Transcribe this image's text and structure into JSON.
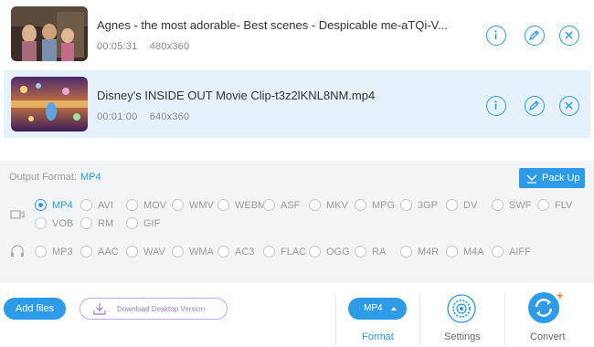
{
  "files": [
    {
      "title": "Agnes - the most adorable- Best scenes - Despicable me-aTQi-V...",
      "duration": "00:05:31",
      "resolution": "480x360",
      "selected": false,
      "thumbnail_icon": "video-thumbnail"
    },
    {
      "title": "Disney's INSIDE OUT Movie Clip-t3z2lKNL8NM.mp4",
      "duration": "00:01:00",
      "resolution": "640x360",
      "selected": true,
      "thumbnail_icon": "video-thumbnail"
    }
  ],
  "row_icons": [
    "info-icon",
    "edit-icon",
    "remove-icon"
  ],
  "output": {
    "label": "Output Format:",
    "value": "MP4",
    "pack_up_label": "Pack Up"
  },
  "video_formats": [
    "MP4",
    "AVI",
    "MOV",
    "WMV",
    "WEBM",
    "ASF",
    "MKV",
    "MPG",
    "3GP",
    "DV",
    "SWF",
    "FLV",
    "VOB",
    "RM",
    "GIF"
  ],
  "audio_formats": [
    "MP3",
    "AAC",
    "WAV",
    "WMA",
    "AC3",
    "FLAC",
    "OGG",
    "RA",
    "M4R",
    "M4A",
    "AIFF"
  ],
  "selected_format": "MP4",
  "bottom": {
    "add_files": "Add files",
    "download": "Download Desktop Version",
    "format_pill": "MP4",
    "format_label": "Format",
    "settings_label": "Settings",
    "convert_label": "Convert"
  },
  "colors": {
    "accent": "#2d9be8",
    "selected_row": "#e6f2fb",
    "panel_bg": "#f2f4f6",
    "download_border": "#c6a8e8",
    "new_badge": "#ff7a3d"
  }
}
